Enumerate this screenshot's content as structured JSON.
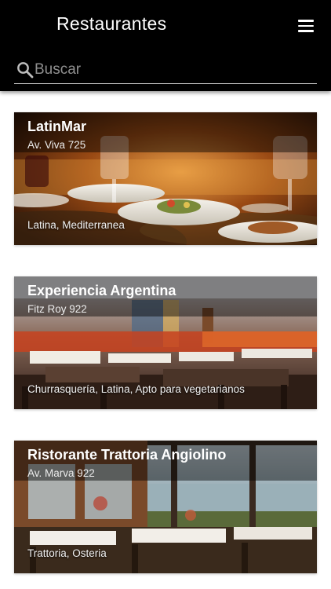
{
  "header": {
    "title": "Restaurantes",
    "menu_icon": "hamburger-menu-icon"
  },
  "search": {
    "placeholder": "Buscar",
    "value": "",
    "icon": "search-icon"
  },
  "colors": {
    "header_bg": "#000000",
    "header_text": "#ffffff",
    "placeholder": "#8f8f8f"
  },
  "restaurants": [
    {
      "name": "LatinMar",
      "address": "Av. Viva 725",
      "tags": "Latina, Mediterranea"
    },
    {
      "name": "Experiencia Argentina",
      "address": "Fitz Roy 922",
      "tags": "Churrasquería, Latina, Apto para vegetarianos"
    },
    {
      "name": "Ristorante Trattoria Angiolino",
      "address": "Av. Marva 922",
      "tags": "Trattoria, Osteria"
    }
  ]
}
